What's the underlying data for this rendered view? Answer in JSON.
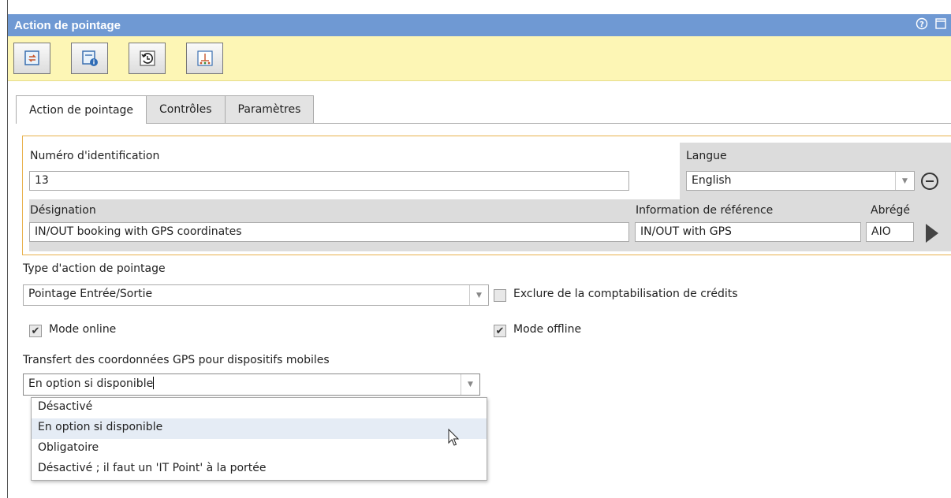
{
  "window": {
    "title": "Action de pointage"
  },
  "toolbar": {
    "buttons": [
      {
        "icon": "refresh-record-icon"
      },
      {
        "icon": "info-card-icon"
      },
      {
        "icon": "history-icon"
      },
      {
        "icon": "structure-chart-icon"
      }
    ]
  },
  "tabs": [
    {
      "label": "Action de pointage",
      "active": true
    },
    {
      "label": "Contrôles",
      "active": false
    },
    {
      "label": "Paramètres",
      "active": false
    }
  ],
  "form": {
    "id_label": "Numéro d'identification",
    "id_value": "13",
    "language_label": "Langue",
    "language_value": "English",
    "designation_label": "Désignation",
    "designation_value": "IN/OUT booking with GPS coordinates",
    "reference_label": "Information de référence",
    "reference_value": "IN/OUT with GPS",
    "abbrev_label": "Abrégé",
    "abbrev_value": "AIO",
    "type_label": "Type d'action de pointage",
    "type_value": "Pointage Entrée/Sortie",
    "exclude_label": "Exclure de la comptabilisation de crédits",
    "exclude_checked": false,
    "online_label": "Mode online",
    "online_checked": true,
    "offline_label": "Mode offline",
    "offline_checked": true,
    "gps_label": "Transfert des coordonnées GPS pour dispositifs mobiles",
    "gps_value": "En option si disponible",
    "gps_options": [
      "Désactivé",
      "En option si disponible",
      "Obligatoire",
      "Désactivé ; il faut un 'IT Point' à la portée"
    ]
  },
  "colors": {
    "titlebar": "#6f99d3",
    "toolbar": "#fdf6b5",
    "group_border": "#e8b04b",
    "hover_row": "#e5ecf5"
  }
}
